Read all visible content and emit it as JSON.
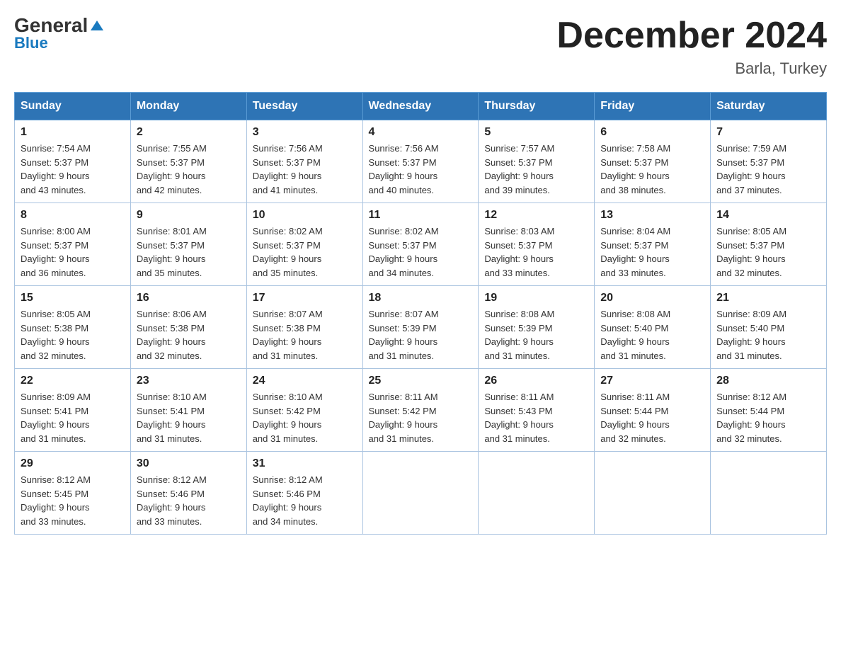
{
  "logo": {
    "general": "General",
    "blue": "Blue"
  },
  "header": {
    "title": "December 2024",
    "subtitle": "Barla, Turkey"
  },
  "weekdays": [
    "Sunday",
    "Monday",
    "Tuesday",
    "Wednesday",
    "Thursday",
    "Friday",
    "Saturday"
  ],
  "weeks": [
    [
      {
        "day": "1",
        "sunrise": "7:54 AM",
        "sunset": "5:37 PM",
        "daylight": "9 hours and 43 minutes."
      },
      {
        "day": "2",
        "sunrise": "7:55 AM",
        "sunset": "5:37 PM",
        "daylight": "9 hours and 42 minutes."
      },
      {
        "day": "3",
        "sunrise": "7:56 AM",
        "sunset": "5:37 PM",
        "daylight": "9 hours and 41 minutes."
      },
      {
        "day": "4",
        "sunrise": "7:56 AM",
        "sunset": "5:37 PM",
        "daylight": "9 hours and 40 minutes."
      },
      {
        "day": "5",
        "sunrise": "7:57 AM",
        "sunset": "5:37 PM",
        "daylight": "9 hours and 39 minutes."
      },
      {
        "day": "6",
        "sunrise": "7:58 AM",
        "sunset": "5:37 PM",
        "daylight": "9 hours and 38 minutes."
      },
      {
        "day": "7",
        "sunrise": "7:59 AM",
        "sunset": "5:37 PM",
        "daylight": "9 hours and 37 minutes."
      }
    ],
    [
      {
        "day": "8",
        "sunrise": "8:00 AM",
        "sunset": "5:37 PM",
        "daylight": "9 hours and 36 minutes."
      },
      {
        "day": "9",
        "sunrise": "8:01 AM",
        "sunset": "5:37 PM",
        "daylight": "9 hours and 35 minutes."
      },
      {
        "day": "10",
        "sunrise": "8:02 AM",
        "sunset": "5:37 PM",
        "daylight": "9 hours and 35 minutes."
      },
      {
        "day": "11",
        "sunrise": "8:02 AM",
        "sunset": "5:37 PM",
        "daylight": "9 hours and 34 minutes."
      },
      {
        "day": "12",
        "sunrise": "8:03 AM",
        "sunset": "5:37 PM",
        "daylight": "9 hours and 33 minutes."
      },
      {
        "day": "13",
        "sunrise": "8:04 AM",
        "sunset": "5:37 PM",
        "daylight": "9 hours and 33 minutes."
      },
      {
        "day": "14",
        "sunrise": "8:05 AM",
        "sunset": "5:37 PM",
        "daylight": "9 hours and 32 minutes."
      }
    ],
    [
      {
        "day": "15",
        "sunrise": "8:05 AM",
        "sunset": "5:38 PM",
        "daylight": "9 hours and 32 minutes."
      },
      {
        "day": "16",
        "sunrise": "8:06 AM",
        "sunset": "5:38 PM",
        "daylight": "9 hours and 32 minutes."
      },
      {
        "day": "17",
        "sunrise": "8:07 AM",
        "sunset": "5:38 PM",
        "daylight": "9 hours and 31 minutes."
      },
      {
        "day": "18",
        "sunrise": "8:07 AM",
        "sunset": "5:39 PM",
        "daylight": "9 hours and 31 minutes."
      },
      {
        "day": "19",
        "sunrise": "8:08 AM",
        "sunset": "5:39 PM",
        "daylight": "9 hours and 31 minutes."
      },
      {
        "day": "20",
        "sunrise": "8:08 AM",
        "sunset": "5:40 PM",
        "daylight": "9 hours and 31 minutes."
      },
      {
        "day": "21",
        "sunrise": "8:09 AM",
        "sunset": "5:40 PM",
        "daylight": "9 hours and 31 minutes."
      }
    ],
    [
      {
        "day": "22",
        "sunrise": "8:09 AM",
        "sunset": "5:41 PM",
        "daylight": "9 hours and 31 minutes."
      },
      {
        "day": "23",
        "sunrise": "8:10 AM",
        "sunset": "5:41 PM",
        "daylight": "9 hours and 31 minutes."
      },
      {
        "day": "24",
        "sunrise": "8:10 AM",
        "sunset": "5:42 PM",
        "daylight": "9 hours and 31 minutes."
      },
      {
        "day": "25",
        "sunrise": "8:11 AM",
        "sunset": "5:42 PM",
        "daylight": "9 hours and 31 minutes."
      },
      {
        "day": "26",
        "sunrise": "8:11 AM",
        "sunset": "5:43 PM",
        "daylight": "9 hours and 31 minutes."
      },
      {
        "day": "27",
        "sunrise": "8:11 AM",
        "sunset": "5:44 PM",
        "daylight": "9 hours and 32 minutes."
      },
      {
        "day": "28",
        "sunrise": "8:12 AM",
        "sunset": "5:44 PM",
        "daylight": "9 hours and 32 minutes."
      }
    ],
    [
      {
        "day": "29",
        "sunrise": "8:12 AM",
        "sunset": "5:45 PM",
        "daylight": "9 hours and 33 minutes."
      },
      {
        "day": "30",
        "sunrise": "8:12 AM",
        "sunset": "5:46 PM",
        "daylight": "9 hours and 33 minutes."
      },
      {
        "day": "31",
        "sunrise": "8:12 AM",
        "sunset": "5:46 PM",
        "daylight": "9 hours and 34 minutes."
      },
      null,
      null,
      null,
      null
    ]
  ],
  "labels": {
    "sunrise": "Sunrise:",
    "sunset": "Sunset:",
    "daylight": "Daylight:"
  }
}
